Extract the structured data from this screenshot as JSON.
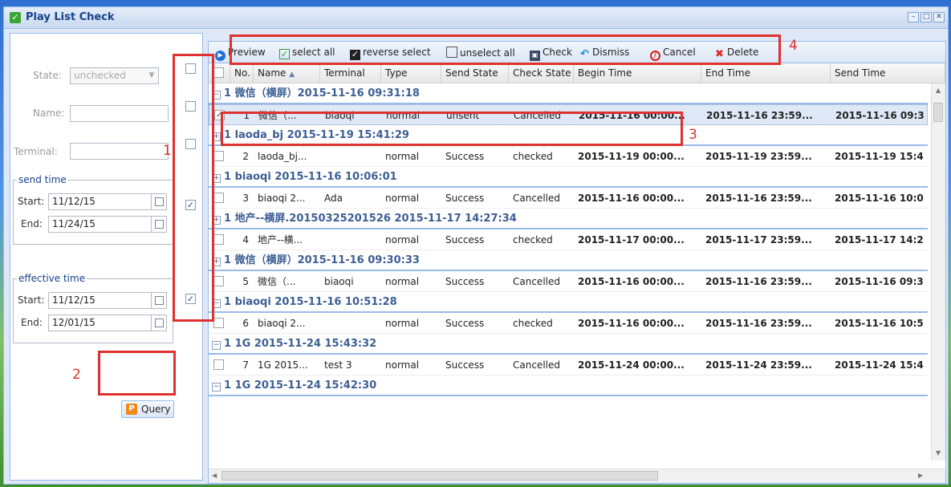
{
  "window": {
    "title": "Play List Check"
  },
  "filter": {
    "state_label": "State:",
    "state_value": "unchecked",
    "name_label": "Name:",
    "name_value": "",
    "terminal_label": "Terminal:",
    "terminal_value": "",
    "send_time": {
      "legend": "send time",
      "start_label": "Start:",
      "start_value": "11/12/15",
      "end_label": "End:",
      "end_value": "11/24/15"
    },
    "effective_time": {
      "legend": "effective time",
      "start_label": "Start:",
      "start_value": "11/12/15",
      "end_label": "End:",
      "end_value": "12/01/15"
    },
    "query_label": "Query"
  },
  "enable_checkboxes": [
    false,
    false,
    false,
    true,
    true
  ],
  "annotations": {
    "n1": "1",
    "n2": "2",
    "n3": "3",
    "n4": "4"
  },
  "toolbar": {
    "preview": "Preview",
    "select_all": "select all",
    "reverse_select": "reverse select",
    "unselect_all": "unselect all",
    "check": "Check",
    "dismiss": "Dismiss",
    "cancel": "Cancel",
    "delete": "Delete"
  },
  "columns": {
    "no": "No.",
    "name": "Name",
    "terminal": "Terminal",
    "type": "Type",
    "send_state": "Send State",
    "check_state": "Check State",
    "begin_time": "Begin Time",
    "end_time": "End Time",
    "send_time": "Send Time"
  },
  "groups": [
    {
      "title": "1 微信（横屏）2015-11-16 09:31:18",
      "row": {
        "no": "1",
        "name": "微信（...",
        "terminal": "biaoqi",
        "type": "normal",
        "send_state": "unsent",
        "check_state": "Cancelled",
        "begin": "2015-11-16 00:00...",
        "end": "2015-11-16 23:59...",
        "send": "2015-11-16 09:3",
        "checked": true
      }
    },
    {
      "title": "1 laoda_bj 2015-11-19 15:41:29",
      "row": {
        "no": "2",
        "name": "laoda_bj...",
        "terminal": "",
        "type": "normal",
        "send_state": "Success",
        "check_state": "checked",
        "begin": "2015-11-19 00:00...",
        "end": "2015-11-19 23:59...",
        "send": "2015-11-19 15:4",
        "checked": false
      }
    },
    {
      "title": "1 biaoqi 2015-11-16 10:06:01",
      "row": {
        "no": "3",
        "name": "biaoqi 2...",
        "terminal": "Ada",
        "type": "normal",
        "send_state": "Success",
        "check_state": "Cancelled",
        "begin": "2015-11-16 00:00...",
        "end": "2015-11-16 23:59...",
        "send": "2015-11-16 10:0",
        "checked": false
      }
    },
    {
      "title": "1 地产--横屏.20150325201526 2015-11-17 14:27:34",
      "row": {
        "no": "4",
        "name": "地产--横...",
        "terminal": "",
        "type": "normal",
        "send_state": "Success",
        "check_state": "checked",
        "begin": "2015-11-17 00:00...",
        "end": "2015-11-17 23:59...",
        "send": "2015-11-17 14:2",
        "checked": false
      }
    },
    {
      "title": "1 微信（横屏）2015-11-16 09:30:33",
      "row": {
        "no": "5",
        "name": "微信（...",
        "terminal": "biaoqi",
        "type": "normal",
        "send_state": "Success",
        "check_state": "Cancelled",
        "begin": "2015-11-16 00:00...",
        "end": "2015-11-16 23:59...",
        "send": "2015-11-16 09:3",
        "checked": false
      }
    },
    {
      "title": "1 biaoqi 2015-11-16 10:51:28",
      "row": {
        "no": "6",
        "name": "biaoqi 2...",
        "terminal": "",
        "type": "normal",
        "send_state": "Success",
        "check_state": "checked",
        "begin": "2015-11-16 00:00...",
        "end": "2015-11-16 23:59...",
        "send": "2015-11-16 10:5",
        "checked": false
      }
    },
    {
      "title": "1 1G 2015-11-24 15:43:32",
      "row": {
        "no": "7",
        "name": "1G 2015...",
        "terminal": "test 3",
        "type": "normal",
        "send_state": "Success",
        "check_state": "Cancelled",
        "begin": "2015-11-24 00:00...",
        "end": "2015-11-24 23:59...",
        "send": "2015-11-24 15:4",
        "checked": false
      }
    },
    {
      "title": "1 1G 2015-11-24 15:42:30",
      "row": null
    }
  ]
}
